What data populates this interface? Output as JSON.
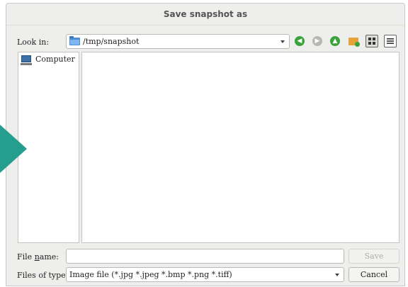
{
  "window": {
    "title": "Save snapshot as"
  },
  "lookin": {
    "label": "Look in:",
    "path": "/tmp/snapshot"
  },
  "toolbar": {
    "icons": [
      "back-icon",
      "forward-icon",
      "parent-dir-icon",
      "new-folder-icon",
      "list-view-icon",
      "detail-view-icon"
    ]
  },
  "sidebar": {
    "items": [
      {
        "label": "Computer",
        "icon": "computer-icon"
      }
    ]
  },
  "filename": {
    "label_pre": "File ",
    "label_accel": "n",
    "label_post": "ame:",
    "value": ""
  },
  "filetype": {
    "label": "Files of type:",
    "value": "Image file (*.jpg *.jpeg *.bmp *.png *.tiff)"
  },
  "buttons": {
    "save": "Save",
    "cancel": "Cancel"
  },
  "colors": {
    "accent": "#249e8e",
    "nav_green": "#3aa23a",
    "folder_blue": "#4a8fd6"
  }
}
